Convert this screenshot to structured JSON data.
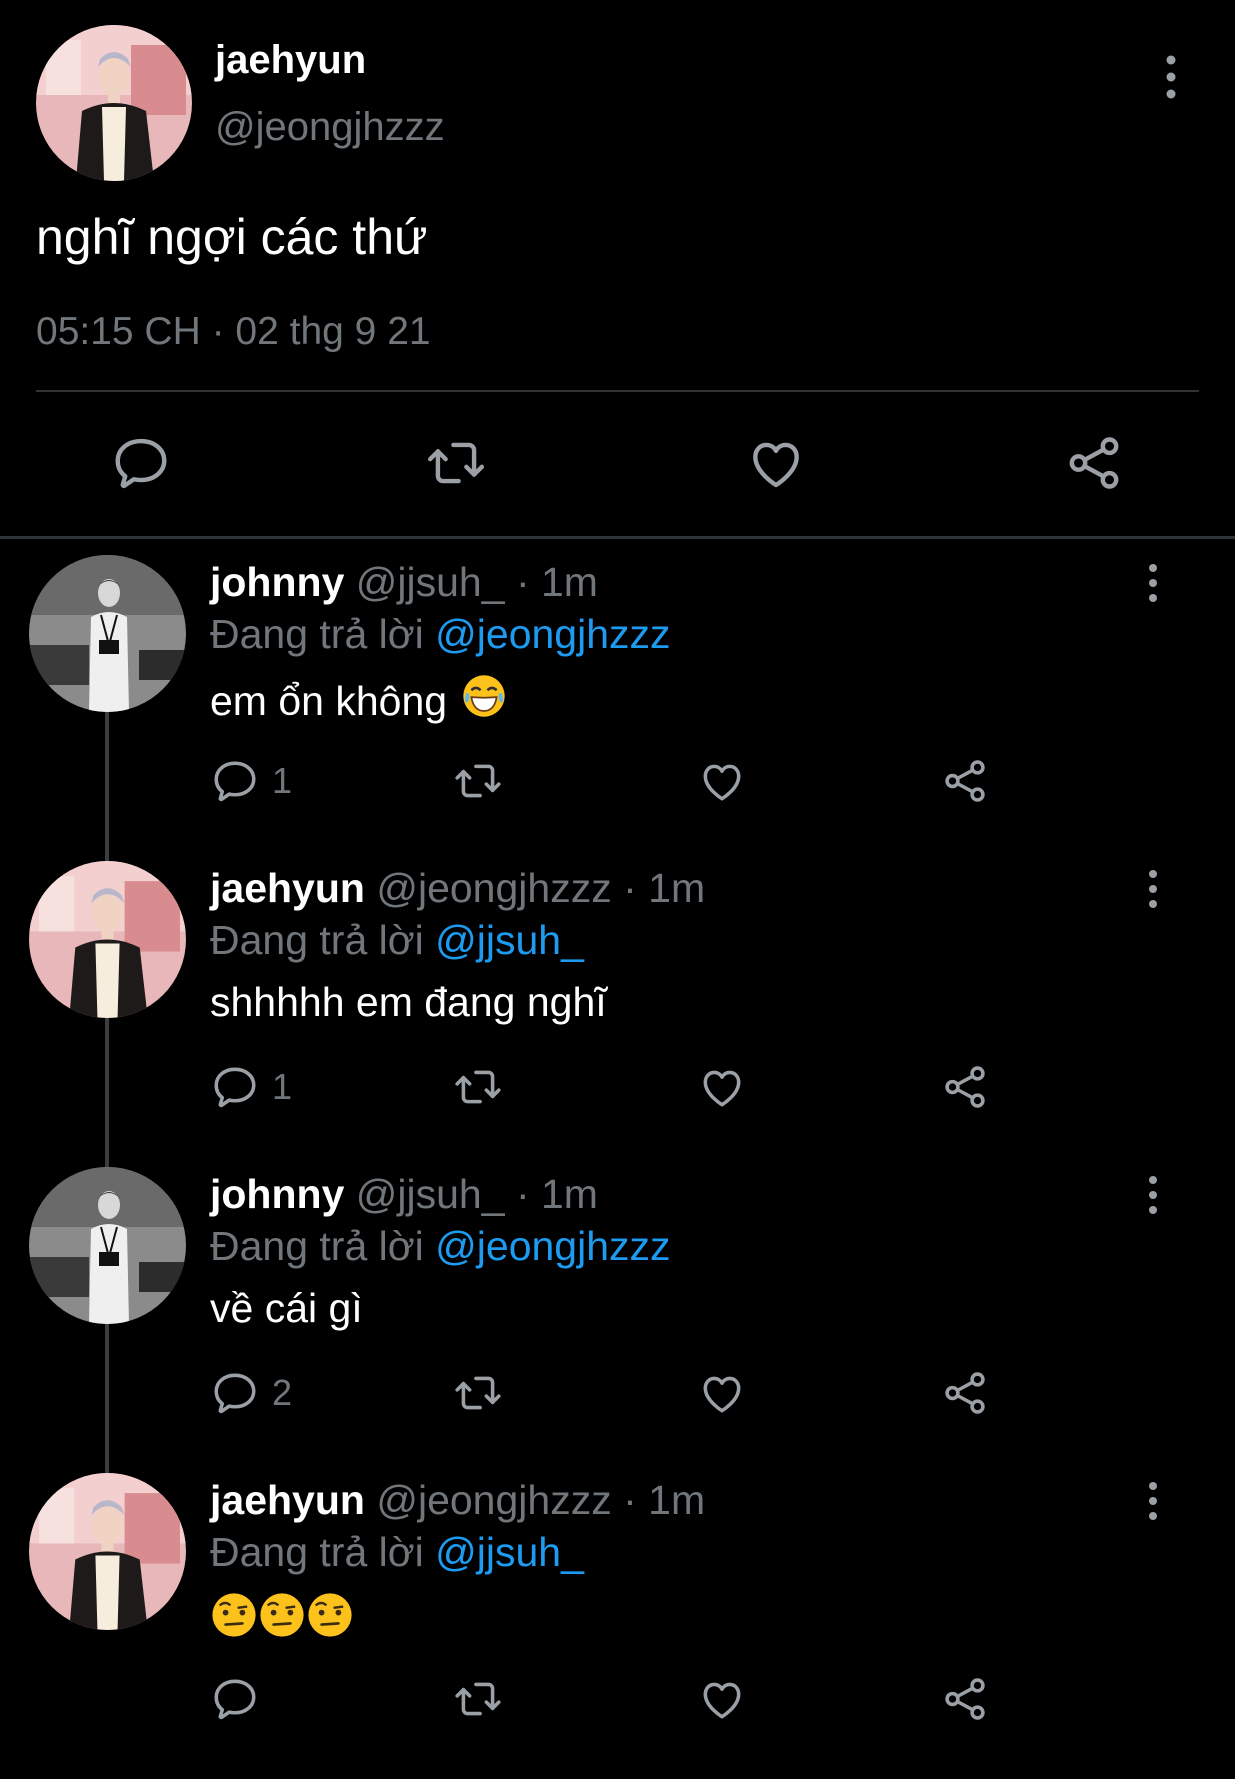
{
  "main_tweet": {
    "name": "jaehyun",
    "handle": "@jeongjhzzz",
    "text": "nghĩ ngợi các thứ",
    "timestamp": "05:15 CH · 02 thg 9 21",
    "actions": [
      "reply-icon",
      "retweet-icon",
      "like-icon",
      "share-icon"
    ]
  },
  "replies": [
    {
      "name": "johnny",
      "handle": "@jjsuh_",
      "dot": "·",
      "time": "1m",
      "replying_prefix": "Đang trả lời",
      "replying_to": "@jeongjhzzz",
      "text": "em ổn không",
      "emoji": [
        "face-with-tears-of-joy"
      ],
      "reply_count": "1"
    },
    {
      "name": "jaehyun",
      "handle": "@jeongjhzzz",
      "dot": "·",
      "time": "1m",
      "replying_prefix": "Đang trả lời",
      "replying_to": "@jjsuh_",
      "text": "shhhhh em đang nghĩ",
      "emoji": [],
      "reply_count": "1"
    },
    {
      "name": "johnny",
      "handle": "@jjsuh_",
      "dot": "·",
      "time": "1m",
      "replying_prefix": "Đang trả lời",
      "replying_to": "@jeongjhzzz",
      "text": "về cái gì",
      "emoji": [],
      "reply_count": "2"
    },
    {
      "name": "jaehyun",
      "handle": "@jeongjhzzz",
      "dot": "·",
      "time": "1m",
      "replying_prefix": "Đang trả lời",
      "replying_to": "@jjsuh_",
      "text": "",
      "emoji": [
        "face-with-raised-eyebrow",
        "face-with-raised-eyebrow",
        "face-with-raised-eyebrow"
      ],
      "reply_count": ""
    }
  ],
  "colors": {
    "background": "#000000",
    "text": "#ffffff",
    "muted": "#71767b",
    "mention": "#1d9bf0",
    "divider": "#2f3336"
  }
}
